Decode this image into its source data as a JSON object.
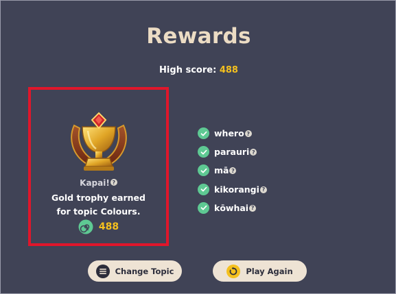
{
  "header": {
    "title": "Rewards"
  },
  "high_score": {
    "label": "High score:",
    "value": "488"
  },
  "reward": {
    "title": "Kapai!",
    "message_line1": "Gold trophy earned",
    "message_line2": "for topic Colours.",
    "points": "488",
    "trophy_icon": "gold-trophy-icon",
    "points_icon": "spiral-koru-icon"
  },
  "words": [
    {
      "label": "whero",
      "status": "correct"
    },
    {
      "label": "parauri",
      "status": "correct"
    },
    {
      "label": "mā",
      "status": "correct"
    },
    {
      "label": "kikorangi",
      "status": "correct"
    },
    {
      "label": "kōwhai",
      "status": "correct"
    }
  ],
  "help_glyph": "?",
  "buttons": {
    "change_topic": "Change Topic",
    "play_again": "Play Again"
  },
  "colors": {
    "background": "#404356",
    "title": "#ecdcc4",
    "accent_gold": "#f4c01e",
    "highlight_border": "#e0162b",
    "check_green": "#5ec993",
    "button_bg": "#eee3d4"
  }
}
